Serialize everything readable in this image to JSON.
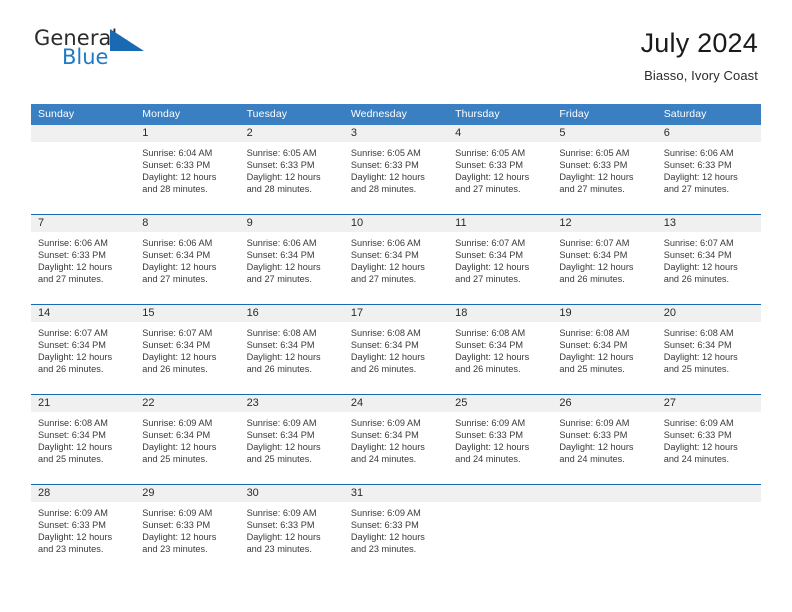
{
  "brand": {
    "name_top": "General",
    "name_bottom": "Blue",
    "triangle_color": "#1a69b3",
    "blue_color": "#1f7ac4"
  },
  "header": {
    "month_title": "July 2024",
    "location": "Biasso, Ivory Coast"
  },
  "theme": {
    "header_bar_color": "#3a7fc1",
    "row_divider_color": "#1a69b3",
    "day_strip_color": "#f0f0f0"
  },
  "calendar": {
    "weekdays": [
      "Sunday",
      "Monday",
      "Tuesday",
      "Wednesday",
      "Thursday",
      "Friday",
      "Saturday"
    ],
    "weeks": [
      [
        {
          "day": "",
          "sunrise": "",
          "sunset": "",
          "daylight_line1": "",
          "daylight_line2": ""
        },
        {
          "day": "1",
          "sunrise": "Sunrise: 6:04 AM",
          "sunset": "Sunset: 6:33 PM",
          "daylight_line1": "Daylight: 12 hours",
          "daylight_line2": "and 28 minutes."
        },
        {
          "day": "2",
          "sunrise": "Sunrise: 6:05 AM",
          "sunset": "Sunset: 6:33 PM",
          "daylight_line1": "Daylight: 12 hours",
          "daylight_line2": "and 28 minutes."
        },
        {
          "day": "3",
          "sunrise": "Sunrise: 6:05 AM",
          "sunset": "Sunset: 6:33 PM",
          "daylight_line1": "Daylight: 12 hours",
          "daylight_line2": "and 28 minutes."
        },
        {
          "day": "4",
          "sunrise": "Sunrise: 6:05 AM",
          "sunset": "Sunset: 6:33 PM",
          "daylight_line1": "Daylight: 12 hours",
          "daylight_line2": "and 27 minutes."
        },
        {
          "day": "5",
          "sunrise": "Sunrise: 6:05 AM",
          "sunset": "Sunset: 6:33 PM",
          "daylight_line1": "Daylight: 12 hours",
          "daylight_line2": "and 27 minutes."
        },
        {
          "day": "6",
          "sunrise": "Sunrise: 6:06 AM",
          "sunset": "Sunset: 6:33 PM",
          "daylight_line1": "Daylight: 12 hours",
          "daylight_line2": "and 27 minutes."
        }
      ],
      [
        {
          "day": "7",
          "sunrise": "Sunrise: 6:06 AM",
          "sunset": "Sunset: 6:33 PM",
          "daylight_line1": "Daylight: 12 hours",
          "daylight_line2": "and 27 minutes."
        },
        {
          "day": "8",
          "sunrise": "Sunrise: 6:06 AM",
          "sunset": "Sunset: 6:34 PM",
          "daylight_line1": "Daylight: 12 hours",
          "daylight_line2": "and 27 minutes."
        },
        {
          "day": "9",
          "sunrise": "Sunrise: 6:06 AM",
          "sunset": "Sunset: 6:34 PM",
          "daylight_line1": "Daylight: 12 hours",
          "daylight_line2": "and 27 minutes."
        },
        {
          "day": "10",
          "sunrise": "Sunrise: 6:06 AM",
          "sunset": "Sunset: 6:34 PM",
          "daylight_line1": "Daylight: 12 hours",
          "daylight_line2": "and 27 minutes."
        },
        {
          "day": "11",
          "sunrise": "Sunrise: 6:07 AM",
          "sunset": "Sunset: 6:34 PM",
          "daylight_line1": "Daylight: 12 hours",
          "daylight_line2": "and 27 minutes."
        },
        {
          "day": "12",
          "sunrise": "Sunrise: 6:07 AM",
          "sunset": "Sunset: 6:34 PM",
          "daylight_line1": "Daylight: 12 hours",
          "daylight_line2": "and 26 minutes."
        },
        {
          "day": "13",
          "sunrise": "Sunrise: 6:07 AM",
          "sunset": "Sunset: 6:34 PM",
          "daylight_line1": "Daylight: 12 hours",
          "daylight_line2": "and 26 minutes."
        }
      ],
      [
        {
          "day": "14",
          "sunrise": "Sunrise: 6:07 AM",
          "sunset": "Sunset: 6:34 PM",
          "daylight_line1": "Daylight: 12 hours",
          "daylight_line2": "and 26 minutes."
        },
        {
          "day": "15",
          "sunrise": "Sunrise: 6:07 AM",
          "sunset": "Sunset: 6:34 PM",
          "daylight_line1": "Daylight: 12 hours",
          "daylight_line2": "and 26 minutes."
        },
        {
          "day": "16",
          "sunrise": "Sunrise: 6:08 AM",
          "sunset": "Sunset: 6:34 PM",
          "daylight_line1": "Daylight: 12 hours",
          "daylight_line2": "and 26 minutes."
        },
        {
          "day": "17",
          "sunrise": "Sunrise: 6:08 AM",
          "sunset": "Sunset: 6:34 PM",
          "daylight_line1": "Daylight: 12 hours",
          "daylight_line2": "and 26 minutes."
        },
        {
          "day": "18",
          "sunrise": "Sunrise: 6:08 AM",
          "sunset": "Sunset: 6:34 PM",
          "daylight_line1": "Daylight: 12 hours",
          "daylight_line2": "and 26 minutes."
        },
        {
          "day": "19",
          "sunrise": "Sunrise: 6:08 AM",
          "sunset": "Sunset: 6:34 PM",
          "daylight_line1": "Daylight: 12 hours",
          "daylight_line2": "and 25 minutes."
        },
        {
          "day": "20",
          "sunrise": "Sunrise: 6:08 AM",
          "sunset": "Sunset: 6:34 PM",
          "daylight_line1": "Daylight: 12 hours",
          "daylight_line2": "and 25 minutes."
        }
      ],
      [
        {
          "day": "21",
          "sunrise": "Sunrise: 6:08 AM",
          "sunset": "Sunset: 6:34 PM",
          "daylight_line1": "Daylight: 12 hours",
          "daylight_line2": "and 25 minutes."
        },
        {
          "day": "22",
          "sunrise": "Sunrise: 6:09 AM",
          "sunset": "Sunset: 6:34 PM",
          "daylight_line1": "Daylight: 12 hours",
          "daylight_line2": "and 25 minutes."
        },
        {
          "day": "23",
          "sunrise": "Sunrise: 6:09 AM",
          "sunset": "Sunset: 6:34 PM",
          "daylight_line1": "Daylight: 12 hours",
          "daylight_line2": "and 25 minutes."
        },
        {
          "day": "24",
          "sunrise": "Sunrise: 6:09 AM",
          "sunset": "Sunset: 6:34 PM",
          "daylight_line1": "Daylight: 12 hours",
          "daylight_line2": "and 24 minutes."
        },
        {
          "day": "25",
          "sunrise": "Sunrise: 6:09 AM",
          "sunset": "Sunset: 6:33 PM",
          "daylight_line1": "Daylight: 12 hours",
          "daylight_line2": "and 24 minutes."
        },
        {
          "day": "26",
          "sunrise": "Sunrise: 6:09 AM",
          "sunset": "Sunset: 6:33 PM",
          "daylight_line1": "Daylight: 12 hours",
          "daylight_line2": "and 24 minutes."
        },
        {
          "day": "27",
          "sunrise": "Sunrise: 6:09 AM",
          "sunset": "Sunset: 6:33 PM",
          "daylight_line1": "Daylight: 12 hours",
          "daylight_line2": "and 24 minutes."
        }
      ],
      [
        {
          "day": "28",
          "sunrise": "Sunrise: 6:09 AM",
          "sunset": "Sunset: 6:33 PM",
          "daylight_line1": "Daylight: 12 hours",
          "daylight_line2": "and 23 minutes."
        },
        {
          "day": "29",
          "sunrise": "Sunrise: 6:09 AM",
          "sunset": "Sunset: 6:33 PM",
          "daylight_line1": "Daylight: 12 hours",
          "daylight_line2": "and 23 minutes."
        },
        {
          "day": "30",
          "sunrise": "Sunrise: 6:09 AM",
          "sunset": "Sunset: 6:33 PM",
          "daylight_line1": "Daylight: 12 hours",
          "daylight_line2": "and 23 minutes."
        },
        {
          "day": "31",
          "sunrise": "Sunrise: 6:09 AM",
          "sunset": "Sunset: 6:33 PM",
          "daylight_line1": "Daylight: 12 hours",
          "daylight_line2": "and 23 minutes."
        },
        {
          "day": "",
          "sunrise": "",
          "sunset": "",
          "daylight_line1": "",
          "daylight_line2": ""
        },
        {
          "day": "",
          "sunrise": "",
          "sunset": "",
          "daylight_line1": "",
          "daylight_line2": ""
        },
        {
          "day": "",
          "sunrise": "",
          "sunset": "",
          "daylight_line1": "",
          "daylight_line2": ""
        }
      ]
    ]
  }
}
